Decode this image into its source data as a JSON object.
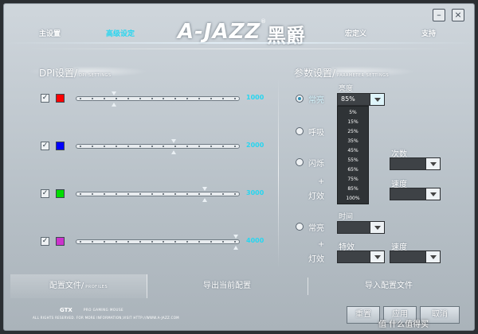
{
  "header": {
    "logo_text": "A-JAZZ",
    "logo_reg": "®",
    "logo_cn": "黑爵",
    "nav": [
      {
        "label": "主设置",
        "active": false
      },
      {
        "label": "高级设定",
        "active": true
      },
      {
        "label": "宏定义",
        "active": false
      },
      {
        "label": "支持",
        "active": false
      }
    ],
    "window_buttons": {
      "minimize": "–",
      "close": "×"
    }
  },
  "dpi": {
    "title": "DPI设置/",
    "subtitle": "DPI SETTINGS",
    "rows": [
      {
        "checked": true,
        "color": "#ff0000",
        "value": "1000",
        "level": 0.22
      },
      {
        "checked": true,
        "color": "#0000ff",
        "value": "2000",
        "level": 0.6
      },
      {
        "checked": true,
        "color": "#00dd00",
        "value": "3000",
        "level": 0.8
      },
      {
        "checked": true,
        "color": "#cc33cc",
        "value": "4000",
        "level": 1.0
      }
    ]
  },
  "params": {
    "title": "参数设置/",
    "subtitle": "PARAMETER SETTINGS",
    "brightness_label": "亮度",
    "brightness_value": "85%",
    "brightness_options": [
      "5%",
      "15%",
      "25%",
      "35%",
      "45%",
      "55%",
      "65%",
      "75%",
      "85%",
      "100%"
    ],
    "mode_steady": "常亮",
    "mode_breath": "呼吸",
    "mode_flash": "闪烁",
    "plus": "+",
    "effect_label": "灯效",
    "count_label": "次数",
    "speed_label": "速度",
    "mode_steady2": "常亮",
    "time_label": "时间",
    "plus2": "+",
    "effect_label2": "灯效",
    "fx_label": "特效",
    "speed_label2": "速度"
  },
  "tabs": {
    "profile": "配置文件/",
    "profile_sub": "PROFILES",
    "export": "导出当前配置",
    "import": "导入配置文件"
  },
  "footer": {
    "brand": "GTX",
    "model": "PRO GAMING MOUSE",
    "copyright": "ALL RIGHTS RESERVED. FOR MORE INFORMATION,VISIT HTTP://WWW.A-JAZZ.COM",
    "reset": "重置",
    "apply": "应用",
    "cancel": "取消",
    "watermark": "值 什么值得买"
  },
  "colors": {
    "accent": "#27d6f0"
  }
}
